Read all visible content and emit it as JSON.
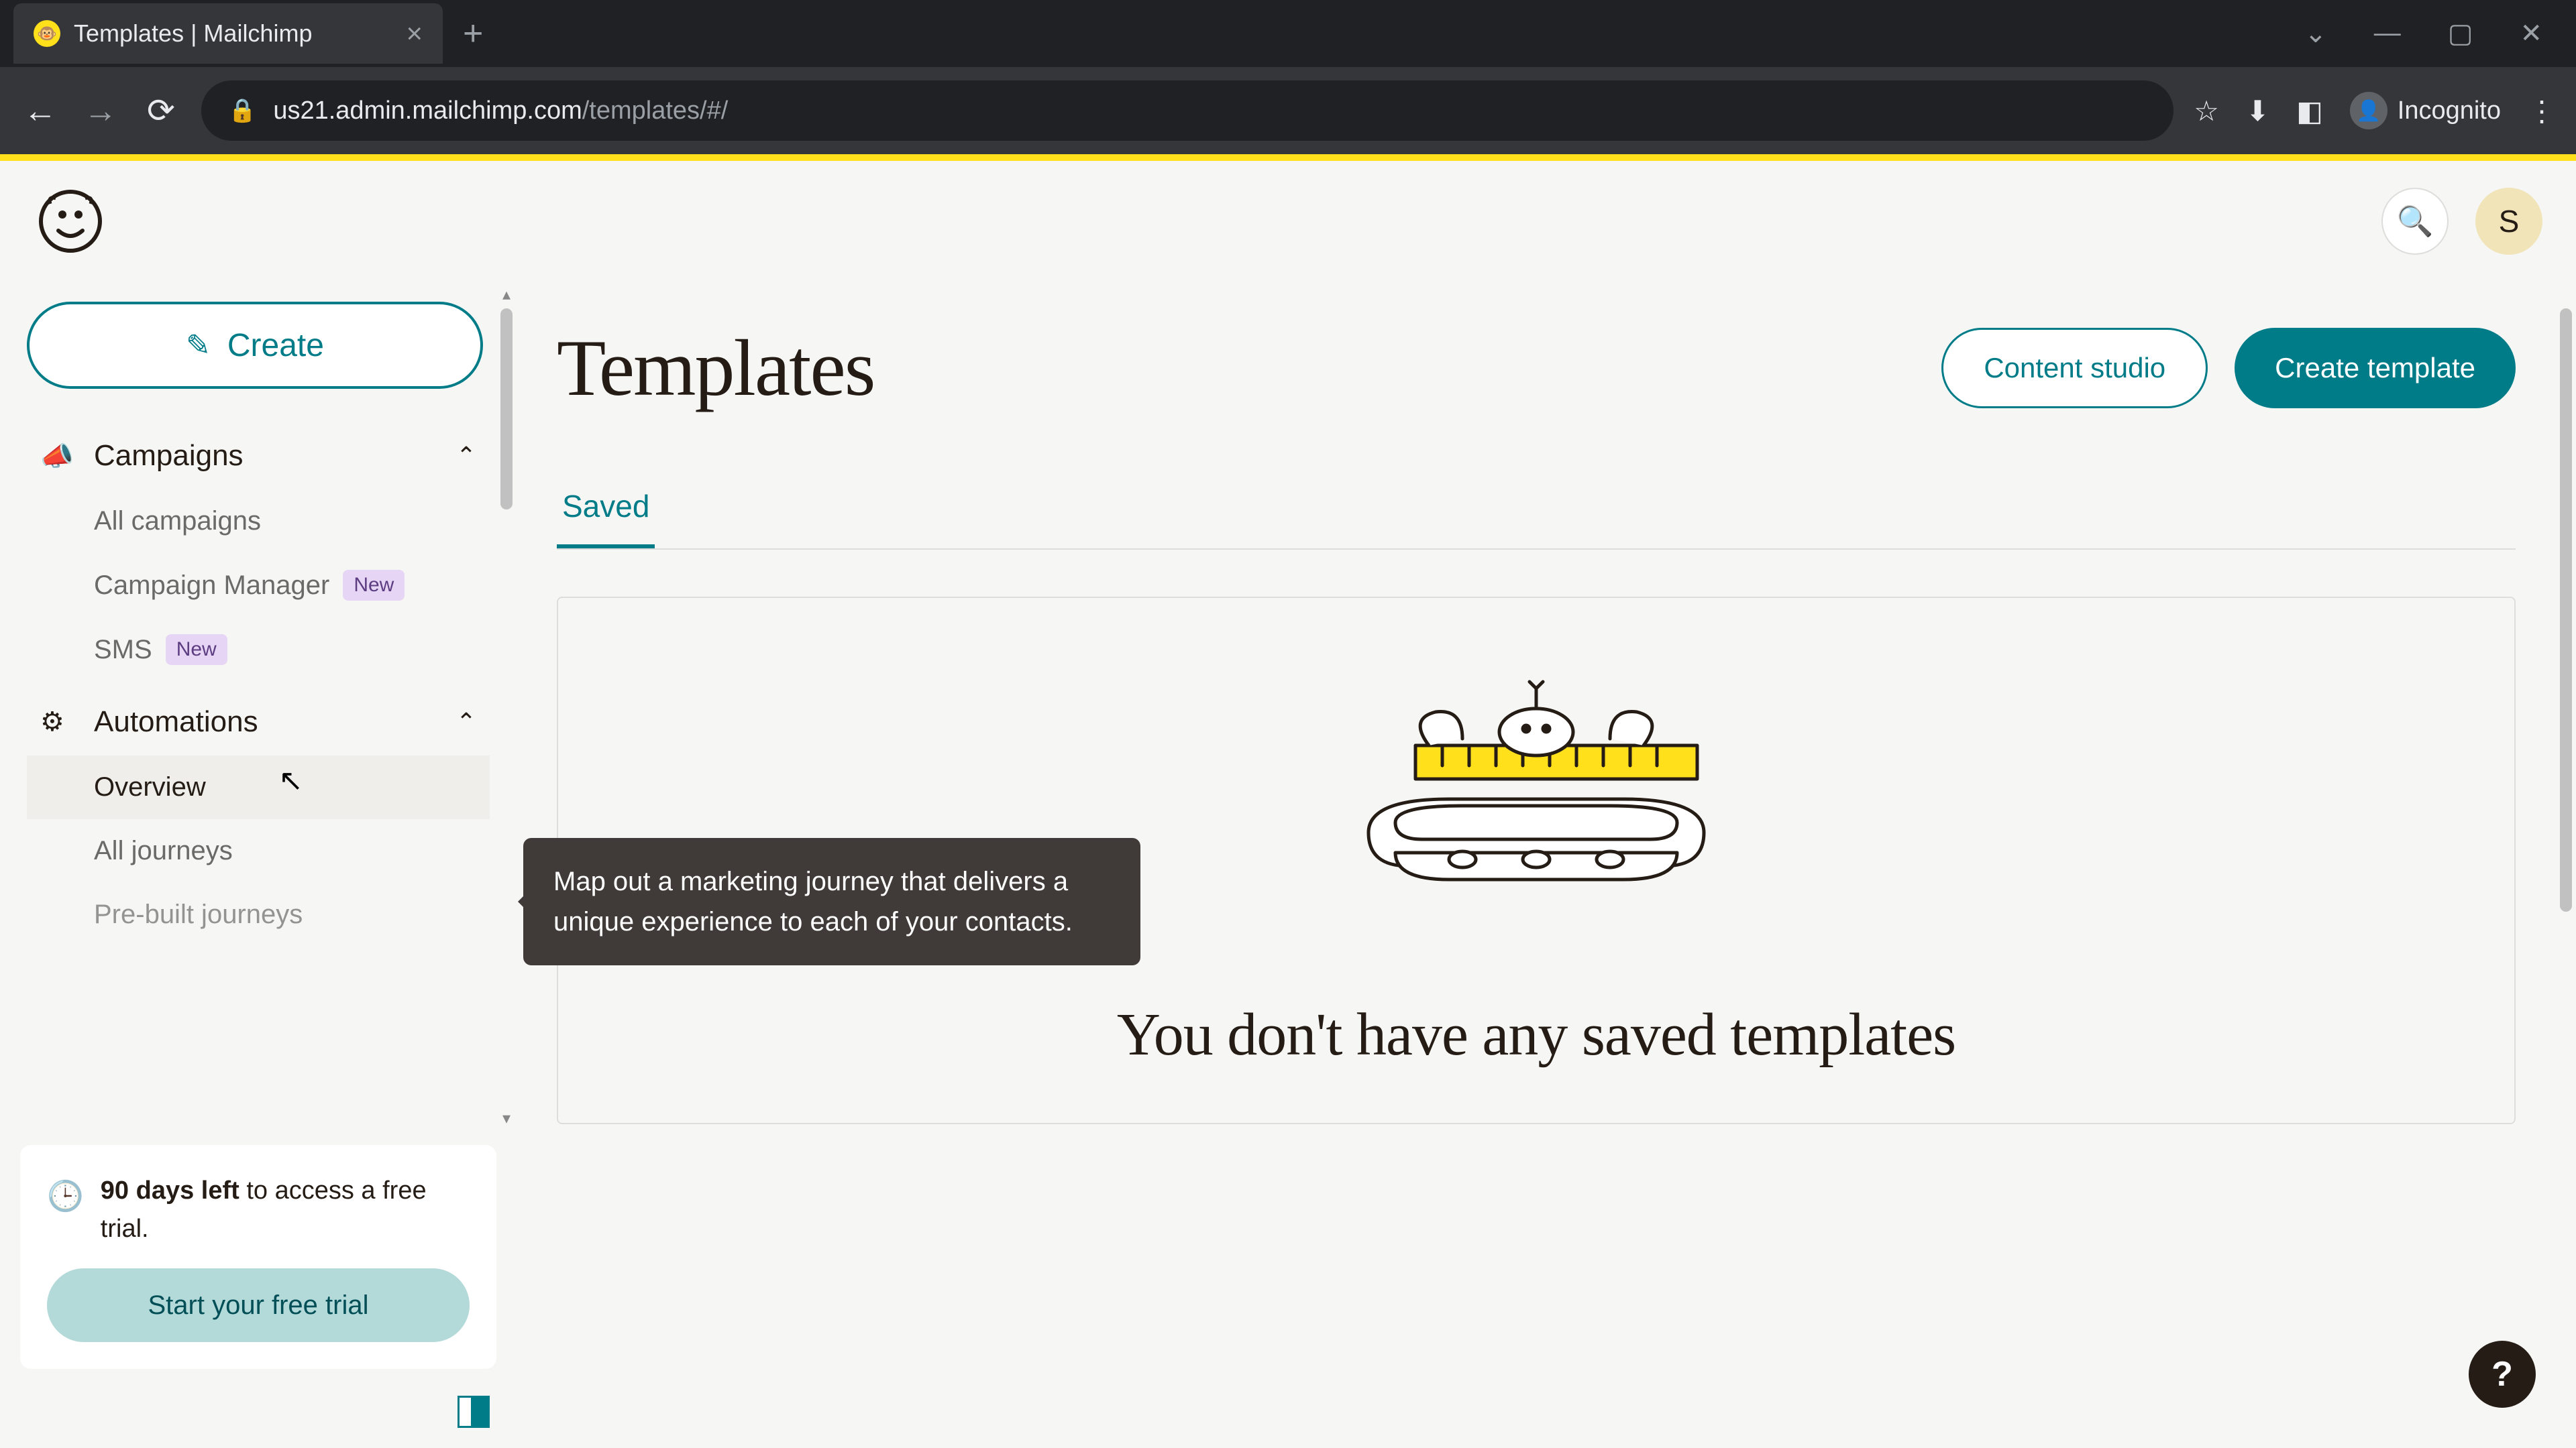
{
  "browser": {
    "tab_title": "Templates | Mailchimp",
    "url_host": "us21.admin.mailchimp.com",
    "url_path": "/templates/#/",
    "incognito_label": "Incognito"
  },
  "header": {
    "avatar_initial": "S"
  },
  "sidebar": {
    "create_label": "Create",
    "sections": [
      {
        "label": "Campaigns",
        "items": [
          {
            "label": "All campaigns"
          },
          {
            "label": "Campaign Manager",
            "badge": "New"
          },
          {
            "label": "SMS",
            "badge": "New"
          }
        ]
      },
      {
        "label": "Automations",
        "items": [
          {
            "label": "Overview"
          },
          {
            "label": "All journeys"
          },
          {
            "label": "Pre-built journeys"
          }
        ]
      }
    ],
    "trial": {
      "days_bold": "90 days left",
      "days_rest": " to access a free trial.",
      "cta": "Start your free trial"
    }
  },
  "tooltip": {
    "text": "Map out a marketing journey that delivers a unique experience to each of your contacts."
  },
  "main": {
    "title": "Templates",
    "content_studio": "Content studio",
    "create_template": "Create template",
    "tab_saved": "Saved",
    "empty_title": "You don't have any saved templates"
  },
  "help": {
    "label": "?"
  }
}
